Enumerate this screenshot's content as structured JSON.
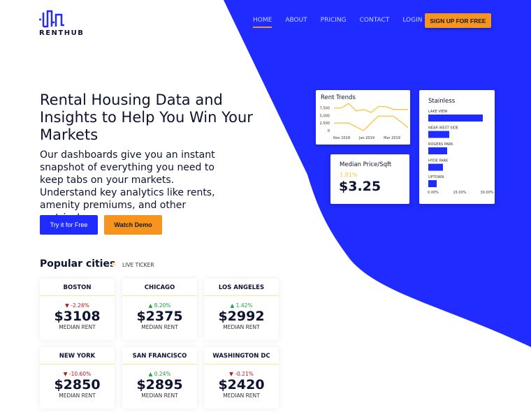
{
  "brand": {
    "name": "RENTHUB",
    "accent": "#1f2bff",
    "orange": "#f7941d"
  },
  "nav": {
    "items": [
      "HOME",
      "ABOUT",
      "PRICING",
      "CONTACT",
      "LOGIN"
    ],
    "active": "HOME",
    "signup": "SIGN UP FOR FREE"
  },
  "hero": {
    "title": "Rental Housing Data and Insights to Help You Win Your Markets",
    "subtitle": "Our dashboards give you an instant snapshot of everything you need to keep tabs on your markets. Understand key analytics like rents, amenity premiums, and other metrics!",
    "try_label": "Try it for Free",
    "demo_label": "Watch Demo"
  },
  "popular": {
    "title": "Popular cities",
    "ticker": "LIVE TICKER",
    "median_label": "MEDIAN RENT",
    "cities": [
      {
        "name": "BOSTON",
        "change": "-2.26%",
        "dir": "down",
        "price": "$3108"
      },
      {
        "name": "CHICAGO",
        "change": "8.20%",
        "dir": "up",
        "price": "$2375"
      },
      {
        "name": "LOS ANGELES",
        "change": "1.42%",
        "dir": "up",
        "price": "$2992"
      },
      {
        "name": "NEW YORK",
        "change": "-10.60%",
        "dir": "down",
        "price": "$2850"
      },
      {
        "name": "SAN FRANCISCO",
        "change": "0.24%",
        "dir": "up",
        "price": "$2895"
      },
      {
        "name": "WASHINGTON DC",
        "change": "-0.21%",
        "dir": "down",
        "price": "$2420"
      }
    ]
  },
  "median_sqft": {
    "title": "Median Price/Sqft",
    "change": "1.81%",
    "value": "$3.25"
  },
  "chart_data": [
    {
      "type": "line",
      "title": "Rent Trends",
      "yticks": [
        "7,500",
        "5,000",
        "2,500",
        "0"
      ],
      "ylim": [
        0,
        9500
      ],
      "xticks": [
        "Nov 2018",
        "Jan 2019",
        "Mar 2019"
      ],
      "series": [
        {
          "values": [
            7500,
            7500,
            9000,
            6500,
            7000,
            6000,
            8000,
            8000,
            7000,
            7000,
            7000
          ]
        },
        {
          "values": [
            2500,
            2500,
            2500,
            1200,
            0,
            2500,
            4800,
            4800,
            4800,
            3000,
            1000
          ]
        }
      ],
      "color": "#fcc33c"
    },
    {
      "type": "bar",
      "title": "Stainless",
      "orientation": "horizontal",
      "categories": [
        "LAKE VIEW",
        "NEAR WEST SIDE",
        "ROGERS PARK",
        "HYDE PARK",
        "UPTOWN"
      ],
      "values": [
        26,
        10,
        9,
        7,
        4
      ],
      "xlim": [
        0,
        30
      ],
      "xticks": [
        "0.00%",
        "15.00%",
        "30.00%"
      ],
      "color": "#1f2bff"
    }
  ]
}
